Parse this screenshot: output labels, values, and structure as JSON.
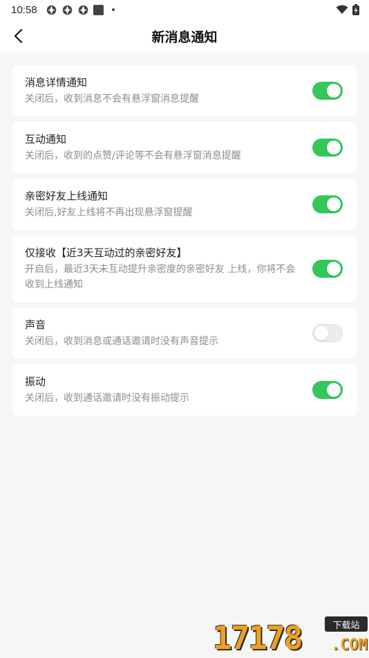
{
  "status_bar": {
    "time": "10:58"
  },
  "header": {
    "title": "新消息通知"
  },
  "settings": [
    {
      "title": "消息详情通知",
      "desc": "关闭后，收到消息不会有悬浮窗消息提醒",
      "enabled": true
    },
    {
      "title": "互动通知",
      "desc": "关闭后，收到的点赞/评论等不会有悬浮窗消息提醒",
      "enabled": true
    },
    {
      "title": "亲密好友上线通知",
      "desc": "关闭后,好友上线将不再出现悬浮窗提醒",
      "enabled": true
    },
    {
      "title": "仅接收【近3天互动过的亲密好友】",
      "desc": "开启后，最近3天未互动提升亲密度的亲密好友 上线，你将不会收到上线通知",
      "enabled": true
    },
    {
      "title": "声音",
      "desc": "关闭后，收到消息或通话邀请时没有声音提示",
      "enabled": false
    },
    {
      "title": "振动",
      "desc": "关闭后，收到通话邀请时没有振动提示",
      "enabled": true
    }
  ],
  "colors": {
    "toggle_on": "#34c759",
    "toggle_off": "#ececec",
    "background": "#f6f6f6"
  },
  "watermark": {
    "digits": "17178",
    "badge": "下载站",
    "domain": ".COM"
  }
}
